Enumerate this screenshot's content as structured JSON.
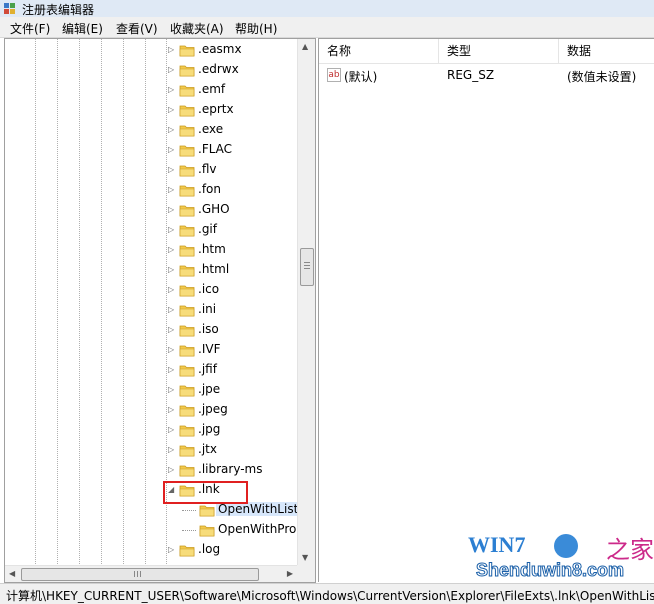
{
  "window": {
    "title": "注册表编辑器"
  },
  "menu": [
    "文件(F)",
    "编辑(E)",
    "查看(V)",
    "收藏夹(A)",
    "帮助(H)"
  ],
  "tree": {
    "items": [
      {
        "label": ".easmx",
        "expander": "▷"
      },
      {
        "label": ".edrwx",
        "expander": "▷"
      },
      {
        "label": ".emf",
        "expander": "▷"
      },
      {
        "label": ".eprtx",
        "expander": "▷"
      },
      {
        "label": ".exe",
        "expander": "▷"
      },
      {
        "label": ".FLAC",
        "expander": "▷"
      },
      {
        "label": ".flv",
        "expander": "▷"
      },
      {
        "label": ".fon",
        "expander": "▷"
      },
      {
        "label": ".GHO",
        "expander": "▷"
      },
      {
        "label": ".gif",
        "expander": "▷"
      },
      {
        "label": ".htm",
        "expander": "▷"
      },
      {
        "label": ".html",
        "expander": "▷"
      },
      {
        "label": ".ico",
        "expander": "▷"
      },
      {
        "label": ".ini",
        "expander": "▷"
      },
      {
        "label": ".iso",
        "expander": "▷"
      },
      {
        "label": ".IVF",
        "expander": "▷"
      },
      {
        "label": ".jfif",
        "expander": "▷"
      },
      {
        "label": ".jpe",
        "expander": "▷"
      },
      {
        "label": ".jpeg",
        "expander": "▷"
      },
      {
        "label": ".jpg",
        "expander": "▷"
      },
      {
        "label": ".jtx",
        "expander": "▷"
      },
      {
        "label": ".library-ms",
        "expander": "▷"
      },
      {
        "label": ".lnk",
        "expander": "◢"
      },
      {
        "label": "OpenWithList",
        "expander": ""
      },
      {
        "label": "OpenWithProgids",
        "expander": ""
      },
      {
        "label": ".log",
        "expander": "▷"
      }
    ]
  },
  "list": {
    "columns": [
      "名称",
      "类型",
      "数据"
    ],
    "rows": [
      {
        "icon": "ab",
        "name": "(默认)",
        "type": "REG_SZ",
        "data": "(数值未设置)"
      }
    ]
  },
  "status": {
    "path": "计算机\\HKEY_CURRENT_USER\\Software\\Microsoft\\Windows\\CurrentVersion\\Explorer\\FileExts\\.lnk\\OpenWithList"
  },
  "watermark": {
    "line1": "WIN7",
    "line1b": "之家",
    "line2": "Shenduwin8.com"
  },
  "colors": {
    "folder": "#f2c94c",
    "highlight": "#e02020",
    "selection": "#d7e7fb"
  }
}
